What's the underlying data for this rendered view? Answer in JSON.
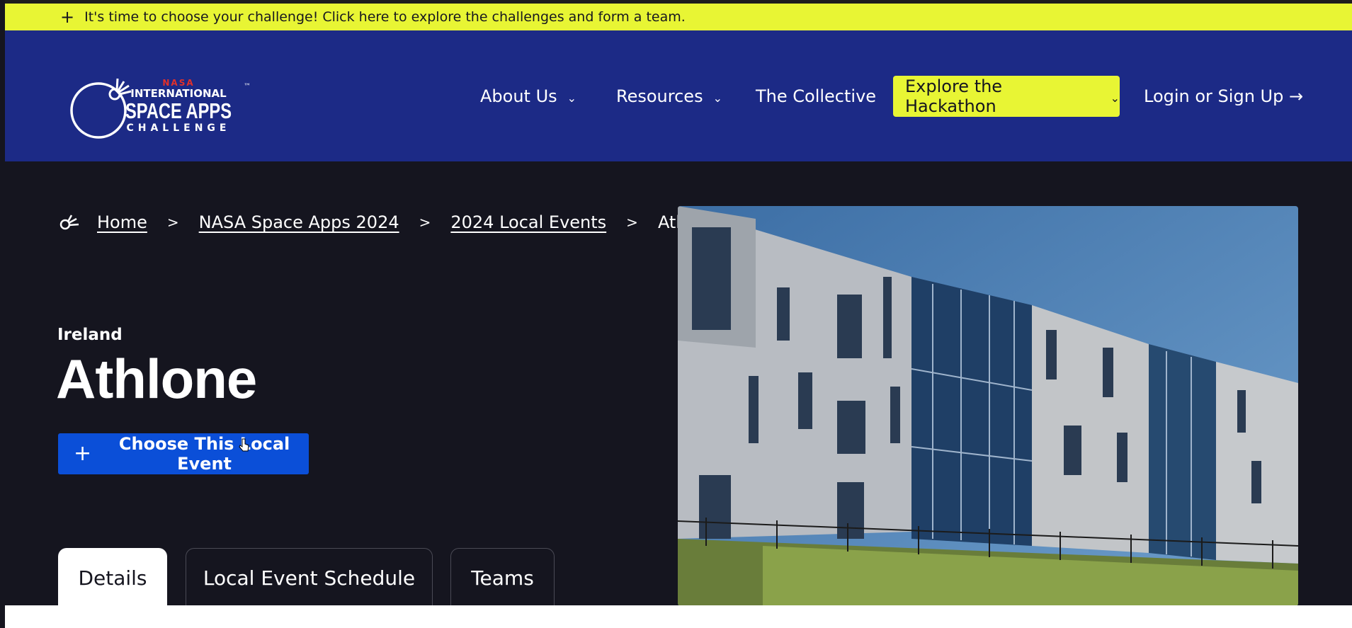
{
  "announcement": {
    "text": "It's time to choose your challenge! Click here to explore the challenges and form a team.",
    "icon": "plus-icon"
  },
  "header": {
    "logo": {
      "nasa": "NASA",
      "line1": "INTERNATIONAL",
      "line2": "SPACE APPS",
      "line3": "CHALLENGE",
      "tm": "™"
    },
    "nav": {
      "about": "About Us",
      "resources": "Resources",
      "collective": "The Collective",
      "explore": "Explore the Hackathon",
      "login": "Login or Sign Up →"
    }
  },
  "breadcrumb": {
    "home": "Home",
    "spaceapps": "NASA Space Apps 2024",
    "local_events": "2024 Local Events",
    "current": "Athlone",
    "separator": ">"
  },
  "event": {
    "country": "Ireland",
    "title": "Athlone",
    "choose_button": "Choose This Local Event"
  },
  "tabs": {
    "details": "Details",
    "schedule": "Local Event Schedule",
    "teams": "Teams",
    "active": "details"
  },
  "colors": {
    "accent_yellow": "#e8f534",
    "header_blue": "#1c2a86",
    "page_dark": "#15151f",
    "button_blue": "#0b4fd8"
  }
}
